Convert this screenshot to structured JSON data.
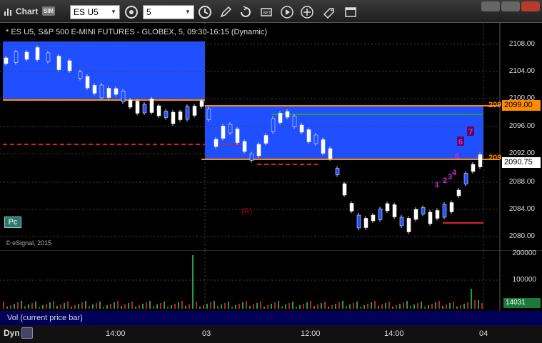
{
  "toolbar": {
    "title": "Chart",
    "sim_badge": "SIM",
    "symbol": "ES U5",
    "interval": "5"
  },
  "chart": {
    "title": "* ES U5, S&P 500 E-MINI FUTURES - GLOBEX, 5, 09:30-16:15 (Dynamic)",
    "copyright": "© eSignal, 2015",
    "pc_label": "Pc",
    "r_label": "(R)",
    "price_axis": [
      "2108.00",
      "2104.00",
      "2100.00",
      "2096.00",
      "2092.00",
      "2088.00",
      "2084.00",
      "2080.00"
    ],
    "price_tag_orange": "2099.00",
    "price_tag_last": "2090.75",
    "edge_label_1": "209",
    "edge_label_2": "209",
    "count_labels": [
      "1",
      "2",
      "3",
      "4",
      "5",
      "6",
      "7"
    ]
  },
  "volume": {
    "axis": [
      "200000",
      "100000"
    ],
    "last": "14031",
    "legend": "Vol (current price bar)"
  },
  "time_axis": {
    "dyn_label": "Dyn",
    "labels": [
      "14:00",
      "03",
      "12:00",
      "14:00",
      "04"
    ]
  },
  "colors": {
    "zone_blue": "#1f4fff",
    "orange_line": "#ff8c00",
    "red_dash": "#e02020",
    "green_line": "#2a9a3a"
  },
  "icons": [
    "chart-icon",
    "sim-badge",
    "timeframe-icon",
    "clock-icon",
    "pencil-icon",
    "refresh-icon",
    "gear-icon",
    "play-icon",
    "link-icon",
    "tag-icon",
    "minimize-icon",
    "maximize-icon",
    "close-icon"
  ]
}
